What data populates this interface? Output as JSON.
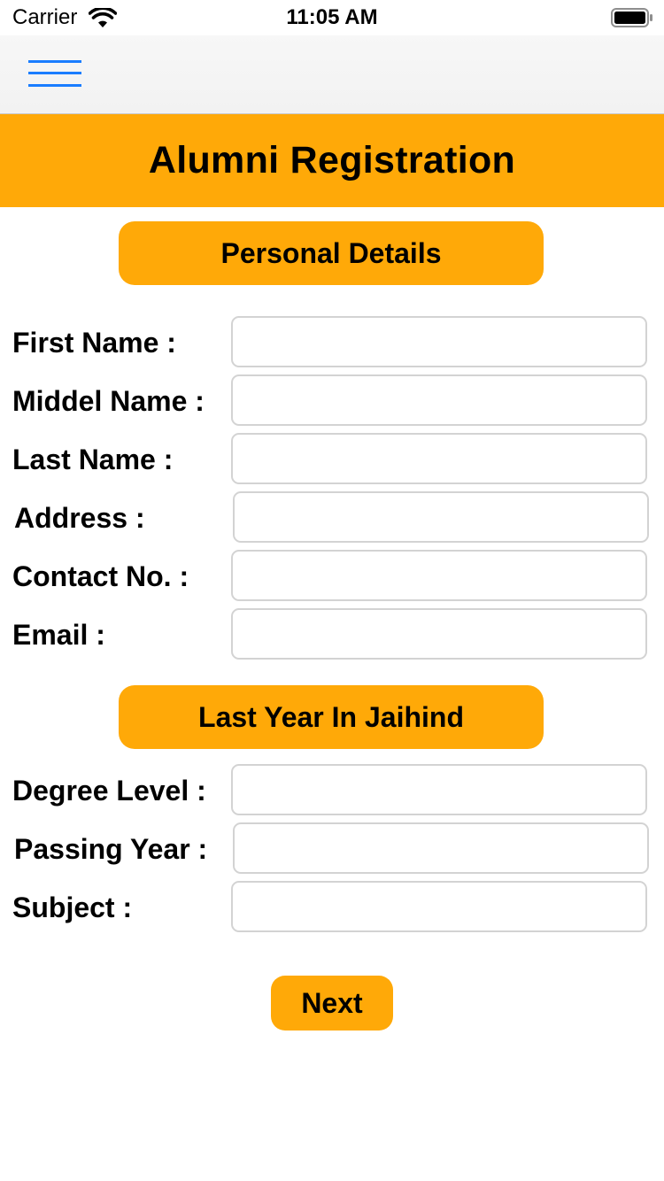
{
  "status_bar": {
    "carrier": "Carrier",
    "time": "11:05 AM"
  },
  "nav": {
    "menu_icon": "hamburger-menu-icon",
    "accent_color": "#1a7dff"
  },
  "header": {
    "title": "Alumni Registration",
    "background_color": "#ffa908"
  },
  "sections": {
    "personal": {
      "title": "Personal Details",
      "fields": [
        {
          "label": "First Name :",
          "value": ""
        },
        {
          "label": "Middel Name :",
          "value": ""
        },
        {
          "label": "Last Name :",
          "value": ""
        },
        {
          "label": "Address :",
          "value": ""
        },
        {
          "label": "Contact No. :",
          "value": ""
        },
        {
          "label": "Email :",
          "value": ""
        }
      ]
    },
    "last_year": {
      "title": "Last Year In Jaihind",
      "fields": [
        {
          "label": "Degree Level :",
          "value": ""
        },
        {
          "label": "Passing Year :",
          "value": ""
        },
        {
          "label": "Subject :",
          "value": ""
        }
      ]
    }
  },
  "actions": {
    "next_label": "Next"
  }
}
